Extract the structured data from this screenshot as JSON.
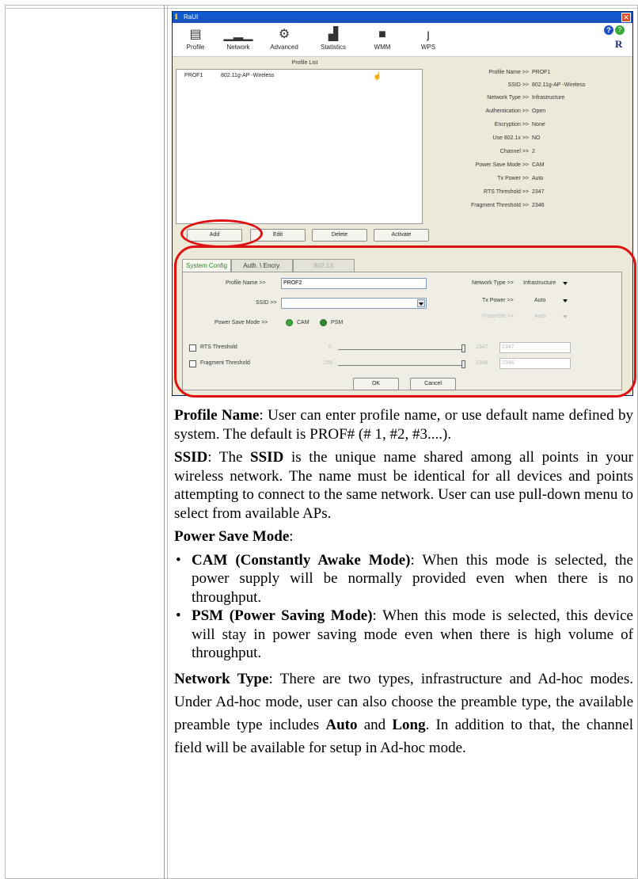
{
  "window": {
    "title": "RaUI",
    "close_glyph": "✕",
    "toolbar": [
      {
        "label": "Profile",
        "icon": "profile-icon",
        "glyph": "▤"
      },
      {
        "label": "Network",
        "icon": "network-icon",
        "glyph": "▁▂▁"
      },
      {
        "label": "Advanced",
        "icon": "advanced-icon",
        "glyph": "⚙"
      },
      {
        "label": "Statistics",
        "icon": "statistics-icon",
        "glyph": "▟"
      },
      {
        "label": "WMM",
        "icon": "wmm-icon",
        "glyph": "■"
      },
      {
        "label": "WPS",
        "icon": "wps-icon",
        "glyph": "ȷ"
      }
    ],
    "help_glyph": "?",
    "status_glyph": "?",
    "brand_glyph": "R"
  },
  "profile_list": {
    "heading": "Profile List",
    "rows": [
      {
        "name": "PROF1",
        "ssid": "802.11g-AP -Wireless",
        "status_glyph": "☝"
      }
    ],
    "buttons": {
      "add": "Add",
      "edit": "Edit",
      "delete": "Delete",
      "activate": "Activate"
    }
  },
  "details": [
    {
      "key": "Profile Name >>",
      "value": "PROF1"
    },
    {
      "key": "SSID >>",
      "value": "802.11g-AP -Wireless"
    },
    {
      "key": "Network Type >>",
      "value": "Infrastructure"
    },
    {
      "key": "Authentication >>",
      "value": "Open"
    },
    {
      "key": "Encryption >>",
      "value": "None"
    },
    {
      "key": "Use 802.1x >>",
      "value": "NO"
    },
    {
      "key": "Channel >>",
      "value": "2"
    },
    {
      "key": "Power Save Mode >>",
      "value": "CAM"
    },
    {
      "key": "Tx Power >>",
      "value": "Auto"
    },
    {
      "key": "RTS Threshold >>",
      "value": "2347"
    },
    {
      "key": "Fragment Threshold >>",
      "value": "2346"
    }
  ],
  "config": {
    "tabs": [
      "System Config",
      "Auth. \\ Encry.",
      "802.1X"
    ],
    "profile_name_label": "Profile Name >>",
    "profile_name_value": "PROF2",
    "ssid_label": "SSID >>",
    "ssid_value": "",
    "power_save_label": "Power Save Mode >>",
    "cam_label": "CAM",
    "psm_label": "PSM",
    "network_type_label": "Network Type >>",
    "network_type_value": "Infrastructure",
    "tx_power_label": "Tx Power >>",
    "tx_power_value": "Auto",
    "preamble_label": "Preamble >>",
    "preamble_value": "Auto",
    "rts_label": "RTS Threshold",
    "rts_min": "0",
    "rts_max": "2347",
    "rts_value": "2347",
    "frag_label": "Fragment Threshold",
    "frag_min": "256",
    "frag_max": "2346",
    "frag_value": "2346",
    "ok": "OK",
    "cancel": "Cancel"
  },
  "text": {
    "p1_term": "Profile Name",
    "p1_body": ": User can enter profile name, or use default name defined by system. The default is PROF# (# 1, #2, #3....).",
    "p2_term": "SSID",
    "p2_a": ": The ",
    "p2_term2": "SSID",
    "p2_b": " is the unique name shared among all points in your wireless network. The name must be identical for all devices and points attempting to connect to the same network. User can use pull-down menu to select from available APs.",
    "p3_term": "Power Save Mode",
    "p3_colon": ":",
    "bullet": "•",
    "li1_term": "CAM (Constantly Awake Mode)",
    "li1_body": ": When this mode is selected, the power supply will be normally provided even when there is no throughput.",
    "li2_term": "PSM (Power Saving Mode)",
    "li2_body": ": When this mode is selected, this device will stay in power saving mode even when there is high volume of throughput.",
    "p4_term": "Network Type",
    "p4_a": ": There are two types, infrastructure and Ad-hoc modes. Under Ad-hoc mode, user can also choose the preamble type, the available preamble type includes ",
    "p4_auto": "Auto",
    "p4_and": " and ",
    "p4_long": "Long",
    "p4_b": ". In addition to that, the channel field will be available for setup in Ad-hoc mode."
  }
}
